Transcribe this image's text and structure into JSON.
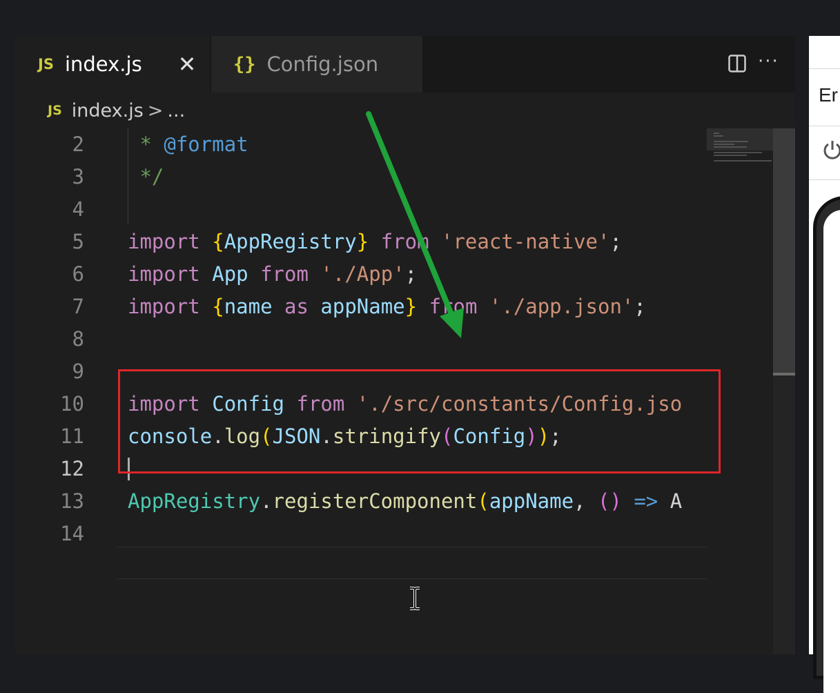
{
  "tabs": [
    {
      "label": "index.js",
      "icon": "js-file-icon",
      "icon_text": "JS",
      "active": true
    },
    {
      "label": "Config.json",
      "icon": "json-file-icon",
      "icon_text": "{}",
      "active": false
    }
  ],
  "tab_close_glyph": "✕",
  "breadcrumb": {
    "icon_text": "JS",
    "file": "index.js",
    "separator": ">",
    "more": "..."
  },
  "line_numbers": {
    "l2": "2",
    "l3": "3",
    "l4": "4",
    "l5": "5",
    "l6": "6",
    "l7": "7",
    "l8": "8",
    "l9": "9",
    "l10": "10",
    "l11": "11",
    "l12": "12",
    "l13": "13",
    "l14": "14"
  },
  "code": {
    "l2": {
      "star": " * ",
      "tag": "@format"
    },
    "l3": {
      "close": " */"
    },
    "l5": {
      "kw": "import",
      "sp": " ",
      "ob": "{",
      "name": "AppRegistry",
      "cb": "}",
      "from": "from",
      "str": "'react-native'",
      "semi": ";"
    },
    "l6": {
      "kw": "import",
      "name": "App",
      "from": "from",
      "str": "'./App'",
      "semi": ";"
    },
    "l7": {
      "kw": "import",
      "ob": "{",
      "name": "name",
      "as": "as",
      "alias": "appName",
      "cb": "}",
      "from": "from",
      "str": "'./app.json'",
      "semi": ";"
    },
    "l10": {
      "kw": "import",
      "name": "Config",
      "from": "from",
      "str": "'./src/constants/Config.jso"
    },
    "l11": {
      "obj": "console",
      "dot": ".",
      "fn": "log",
      "p1": "(",
      "cls": "JSON",
      "dot2": ".",
      "fn2": "stringify",
      "p2": "(",
      "arg": "Config",
      "p3": ")",
      "p4": ")",
      "semi": ";"
    },
    "l13": {
      "obj": "AppRegistry",
      "dot": ".",
      "fn": "registerComponent",
      "p1": "(",
      "arg": "appName",
      "comma": ", ",
      "p2": "()",
      "arrow": "=>",
      "rest": " A"
    }
  },
  "right_panel": {
    "text": "Er"
  },
  "colors": {
    "highlight_box": "#e0252b",
    "arrow": "#1fa33a",
    "keyword": "#c586c0",
    "string": "#ce9178",
    "variable": "#9cdcfe"
  }
}
